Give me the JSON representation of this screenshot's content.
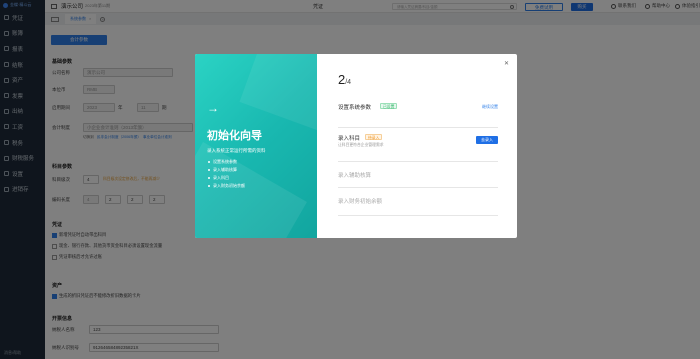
{
  "sidebar": {
    "logo": "金蝶·精斗云",
    "items": [
      {
        "label": "凭证",
        "icon": "voucher-icon"
      },
      {
        "label": "账簿",
        "icon": "ledger-icon"
      },
      {
        "label": "报表",
        "icon": "report-icon"
      },
      {
        "label": "结账",
        "icon": "close-books-icon"
      },
      {
        "label": "资产",
        "icon": "asset-icon"
      },
      {
        "label": "发票",
        "icon": "invoice-icon"
      },
      {
        "label": "出纳",
        "icon": "cashier-icon"
      },
      {
        "label": "工资",
        "icon": "salary-icon"
      },
      {
        "label": "税务",
        "icon": "tax-icon"
      },
      {
        "label": "财税服务",
        "icon": "service-icon"
      },
      {
        "label": "设置",
        "icon": "gear-icon"
      },
      {
        "label": "进销存",
        "icon": "inventory-icon"
      }
    ],
    "bottom": "消息/帮助"
  },
  "topbar": {
    "company": "演示公司",
    "period": "2023年第11期",
    "voucher_select": "凭证",
    "search_placeholder": "请输入凭证摘要/科目/金额",
    "free_trial": "免费试用",
    "buy": "购买",
    "contact": "联系我们",
    "help": "帮助中心",
    "guide": "体验指引"
  },
  "tabbar": {
    "tab": "系统参数"
  },
  "main": {
    "param_button": "会计参数",
    "basic_section": "基础参数",
    "company_label": "公司名称",
    "company_value": "演示公司",
    "currency_label": "本位币",
    "currency_value": "RMB",
    "start_label": "启用期间",
    "start_year": "2023",
    "year_unit": "年",
    "start_month": "11",
    "month_unit": "期",
    "standard_label": "会计制度",
    "standard_value": "小企业会计准则（2013年颁）",
    "standard_link1": "切换到",
    "standard_link2": "民非会计制度（2006年颁）",
    "standard_link3": "事业单位会计准则",
    "subject_section": "科目参数",
    "level_label": "科目级次",
    "level_value": "4",
    "level_note": "科目级次设定修改后，不能再减少",
    "length_label": "编码长度",
    "len1": "4",
    "len2": "2",
    "len3": "2",
    "len4": "2",
    "voucher_section": "凭证",
    "chk1": "新增凭证时自动带出科目",
    "chk2": "现金、银行存款、其他货币资金科目必须设置现金流量",
    "chk3": "凭证审核后才允许过账",
    "asset_section": "资产",
    "chk4": "生成的折旧凭证后不能修改折旧数据的卡片",
    "tax_section": "开票信息",
    "taxpayer_label": "纳税人名称",
    "taxpayer_value": "123",
    "taxid_label": "纳税人识别号",
    "taxid_value": "91264658489235821X"
  },
  "modal": {
    "arrow": "→",
    "title": "初始化向导",
    "subtitle": "录入系统正常运行所需的资料",
    "steps_list": [
      "设置系统参数",
      "录入辅助核算",
      "录入科目",
      "录入财务初始余额"
    ],
    "step_current": "2",
    "step_total": "/4",
    "row1_name": "设置系统参数",
    "row1_badge": "已设置",
    "row1_action": "继续设置",
    "row2_name": "录入科目",
    "row2_badge": "待录入",
    "row2_desc": "让科目更符合企业管理需求",
    "row2_action": "去录入",
    "row3_name": "录入辅助核算",
    "row4_name": "录入财务初始余额"
  },
  "colors": {
    "primary": "#1f6fe5",
    "sidebar": "#1f2b3a",
    "teal": "#1fbfb5"
  }
}
